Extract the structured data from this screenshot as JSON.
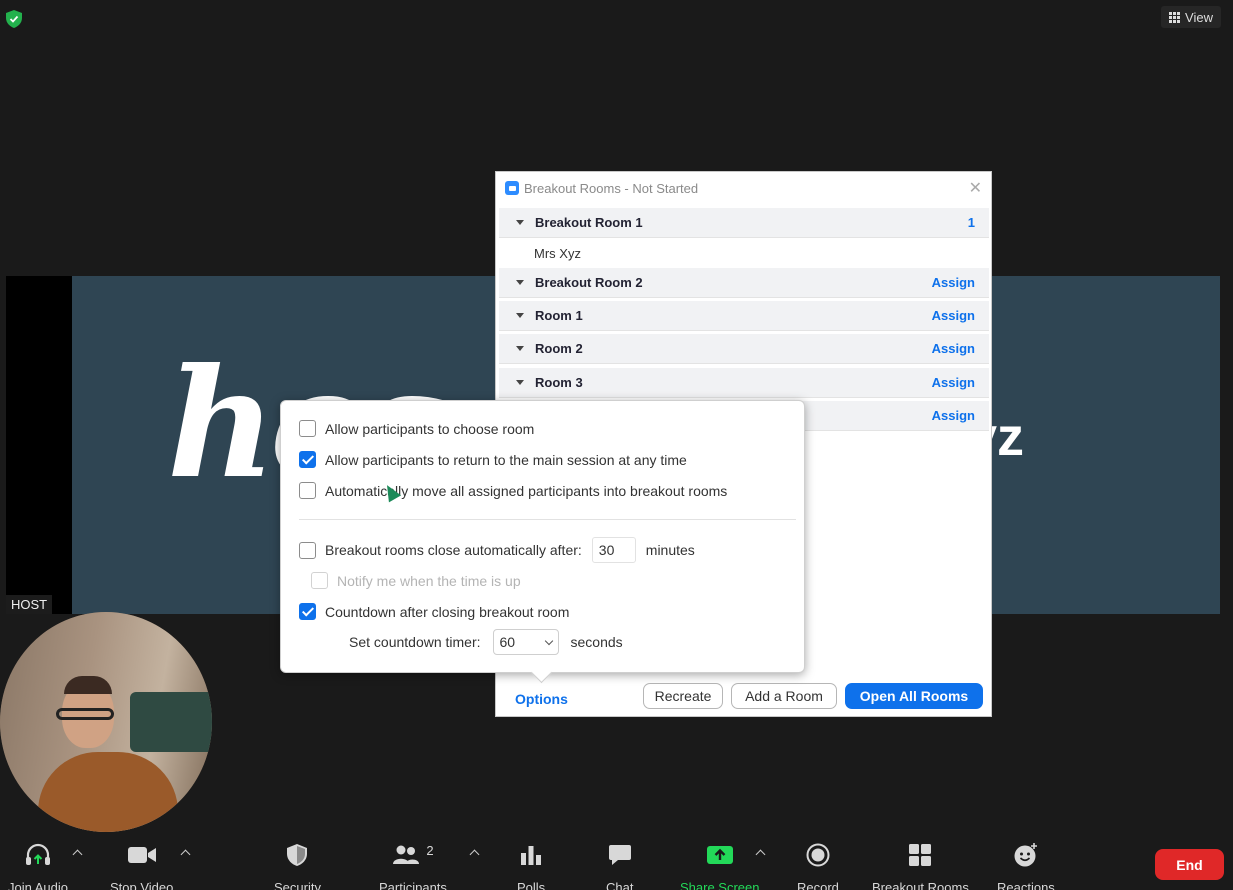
{
  "top": {
    "view_label": "View"
  },
  "share": {
    "slide_text_left": "hos",
    "slide_text_right": "yz",
    "host_label": "HOST"
  },
  "breakout": {
    "title": "Breakout Rooms - Not Started",
    "rooms": [
      {
        "name": "Breakout Room 1",
        "action": "1",
        "members": [
          "Mrs Xyz"
        ]
      },
      {
        "name": "Breakout Room 2",
        "action": "Assign"
      },
      {
        "name": "Room 1",
        "action": "Assign"
      },
      {
        "name": "Room 2",
        "action": "Assign"
      },
      {
        "name": "Room 3",
        "action": "Assign"
      },
      {
        "name": "",
        "action": "Assign"
      }
    ],
    "footer": {
      "options_label": "Options",
      "recreate_label": "Recreate",
      "add_room_label": "Add a Room",
      "open_all_label": "Open All Rooms"
    }
  },
  "options": {
    "allow_choose": {
      "label": "Allow participants to choose room",
      "checked": false
    },
    "allow_return": {
      "label": "Allow participants to return to the main session at any time",
      "checked": true
    },
    "auto_move": {
      "label": "Automatically move all assigned participants into breakout rooms",
      "checked": false
    },
    "auto_close": {
      "label": "Breakout rooms close automatically after:",
      "checked": false,
      "value": "30",
      "unit": "minutes"
    },
    "notify": {
      "label": "Notify me when the time is up",
      "checked": false,
      "disabled": true
    },
    "countdown": {
      "label": "Countdown after closing breakout room",
      "checked": true
    },
    "timer": {
      "label": "Set countdown timer:",
      "value": "60",
      "unit": "seconds"
    }
  },
  "toolbar": {
    "join_audio": "Join Audio",
    "stop_video": "Stop Video",
    "security": "Security",
    "participants": "Participants",
    "participants_count": "2",
    "polls": "Polls",
    "chat": "Chat",
    "share_screen": "Share Screen",
    "record": "Record",
    "breakout_rooms": "Breakout Rooms",
    "reactions": "Reactions",
    "end": "End"
  },
  "colors": {
    "accent": "#0e71eb",
    "end": "#e02828",
    "share_green": "#23d959"
  }
}
